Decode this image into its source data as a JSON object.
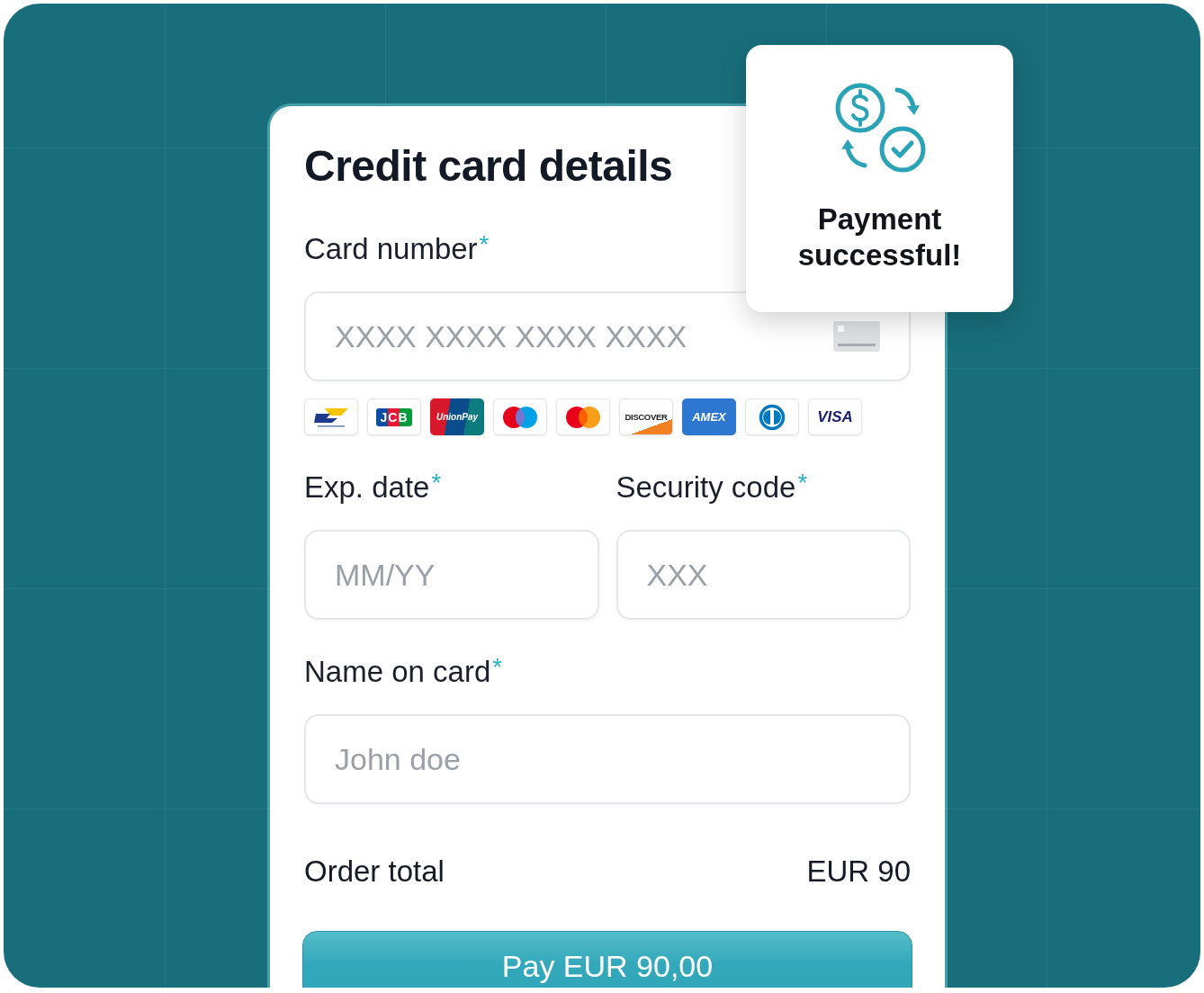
{
  "payment_form": {
    "title": "Credit card details",
    "card_number": {
      "label": "Card number",
      "required_mark": "*",
      "placeholder": "XXXX XXXX XXXX XXXX"
    },
    "card_brands": [
      {
        "kind": "bancontact"
      },
      {
        "kind": "jcb",
        "label": "JCB"
      },
      {
        "kind": "unionpay",
        "label": "UnionPay"
      },
      {
        "kind": "maestro"
      },
      {
        "kind": "mastercard"
      },
      {
        "kind": "discover",
        "label": "DISCOVER"
      },
      {
        "kind": "amex",
        "label": "AMEX"
      },
      {
        "kind": "diners"
      },
      {
        "kind": "visa",
        "label": "VISA"
      }
    ],
    "expiry_date": {
      "label": "Exp. date",
      "required_mark": "*",
      "placeholder": "MM/YY"
    },
    "security_code": {
      "label": "Security code",
      "required_mark": "*",
      "placeholder": "XXX"
    },
    "name_on_card": {
      "label": "Name on card",
      "required_mark": "*",
      "placeholder": "John doe"
    },
    "order_total": {
      "label": "Order total",
      "amount": "EUR 90"
    },
    "pay_button": {
      "label": "Pay EUR 90,00"
    }
  },
  "notification": {
    "message": "Payment successful!"
  }
}
